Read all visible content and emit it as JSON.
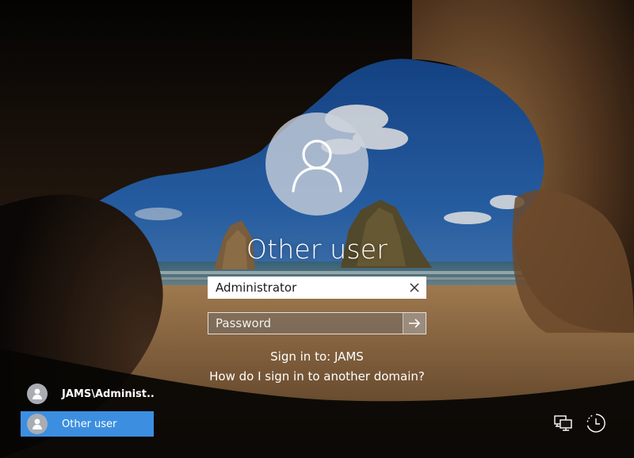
{
  "login": {
    "title": "Other user",
    "username_value": "Administrator",
    "password_placeholder": "Password",
    "sign_in_to": "Sign in to: JAMS",
    "help_link": "How do I sign in to another domain?"
  },
  "user_list": [
    {
      "label": "JAMS\\Administ..",
      "selected": false
    },
    {
      "label": "Other user",
      "selected": true
    }
  ],
  "system_icons": [
    "network-icon",
    "ease-of-access-icon"
  ],
  "colors": {
    "selected_tile": "#3c8fe0",
    "avatar_circle": "#cdd4dc",
    "text": "#ffffff"
  }
}
